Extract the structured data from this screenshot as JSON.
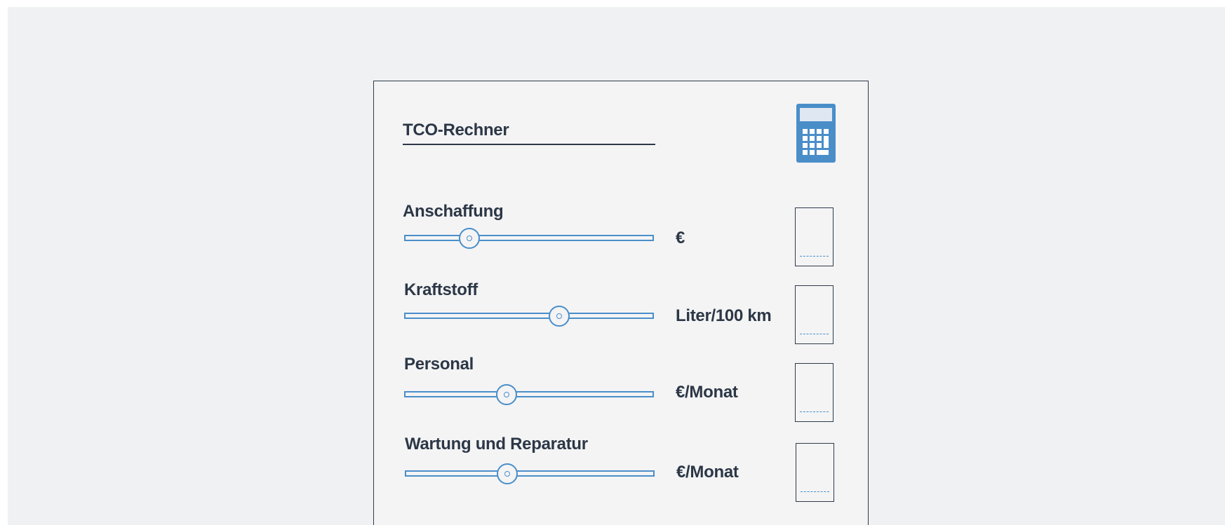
{
  "calculator": {
    "title": "TCO-Rechner",
    "icon": "calculator-icon",
    "accent_color": "#4a8ec9",
    "text_color": "#2c3746",
    "rows": [
      {
        "label": "Anschaffung",
        "unit": "€",
        "slider_fraction": 0.26
      },
      {
        "label": "Kraftstoff",
        "unit": "Liter/100 km",
        "slider_fraction": 0.62
      },
      {
        "label": "Personal",
        "unit": "€/Monat",
        "slider_fraction": 0.41
      },
      {
        "label": "Wartung und Reparatur",
        "unit": "€/Monat",
        "slider_fraction": 0.41
      }
    ]
  }
}
